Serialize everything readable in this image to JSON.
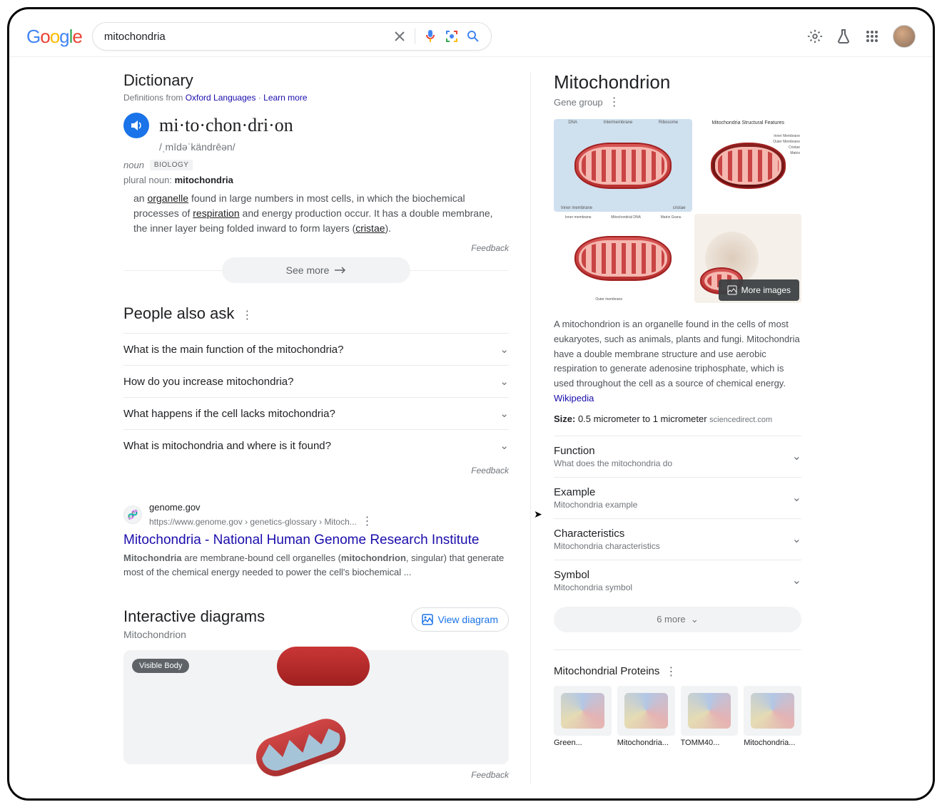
{
  "search": {
    "query": "mitochondria"
  },
  "dictionary": {
    "heading": "Dictionary",
    "subtext_prefix": "Definitions from ",
    "subtext_link": "Oxford Languages",
    "subtext_sep": " · ",
    "learn_more": "Learn more",
    "word": "mi·to·chon·dri·on",
    "phonetic": "/ˌmīdəˈkändrēən/",
    "pos": "noun",
    "field": "BIOLOGY",
    "plural_label": "plural noun: ",
    "plural_value": "mitochondria",
    "def_pre": "an ",
    "def_term1": "organelle",
    "def_mid": " found in large numbers in most cells, in which the biochemical processes of ",
    "def_term2": "respiration",
    "def_post": " and energy production occur. It has a double membrane, the inner layer being folded inward to form layers (",
    "def_term3": "cristae",
    "def_end": ").",
    "feedback": "Feedback",
    "see_more": "See more"
  },
  "paa": {
    "heading": "People also ask",
    "items": [
      "What is the main function of the mitochondria?",
      "How do you increase mitochondria?",
      "What happens if the cell lacks mitochondria?",
      "What is mitochondria and where is it found?"
    ],
    "feedback": "Feedback"
  },
  "result": {
    "domain": "genome.gov",
    "breadcrumb": "https://www.genome.gov › genetics-glossary › Mitoch...",
    "title": "Mitochondria - National Human Genome Research Institute",
    "snip_b1": "Mitochondria",
    "snip_t1": " are membrane-bound cell organelles (",
    "snip_b2": "mitochondrion",
    "snip_t2": ", singular) that generate most of the chemical energy needed to power the cell's biochemical ..."
  },
  "interactive": {
    "heading": "Interactive diagrams",
    "sub": "Mitochondrion",
    "view": "View diagram",
    "badge": "Visible Body",
    "feedback": "Feedback"
  },
  "kp": {
    "title": "Mitochondrion",
    "subtitle": "Gene group",
    "more_images": "More images",
    "description": "A mitochondrion is an organelle found in the cells of most eukaryotes, such as animals, plants and fungi. Mitochondria have a double membrane structure and use aerobic respiration to generate adenosine triphosphate, which is used throughout the cell as a source of chemical energy.",
    "source": "Wikipedia",
    "size_label": "Size:",
    "size_value": " 0.5 micrometer to 1 micrometer ",
    "size_src": "sciencedirect.com",
    "expandables": [
      {
        "title": "Function",
        "sub": "What does the mitochondria do"
      },
      {
        "title": "Example",
        "sub": "Mitochondria example"
      },
      {
        "title": "Characteristics",
        "sub": "Mitochondria characteristics"
      },
      {
        "title": "Symbol",
        "sub": "Mitochondria symbol"
      }
    ],
    "more_count": "6 more",
    "proteins_heading": "Mitochondrial Proteins",
    "proteins": [
      "Green...",
      "Mitochondria...",
      "TOMM40...",
      "Mitochondria..."
    ]
  },
  "img_labels": {
    "img1_a": "Intermembrane",
    "img1_b": "Ribosome",
    "img1_c": "DNA",
    "img1_d": "Inner membrane",
    "img1_e": "cristae",
    "img2_title": "Mitochondria Structural Features",
    "img2_a": "Inner Membrane",
    "img2_b": "Outer Membrane",
    "img2_c": "Cristae",
    "img2_d": "Matrix",
    "img3_a": "Inner membrane",
    "img3_b": "Mitochondrial DNA",
    "img3_c": "Outer membrane",
    "img3_d": "Matrix Granu"
  }
}
